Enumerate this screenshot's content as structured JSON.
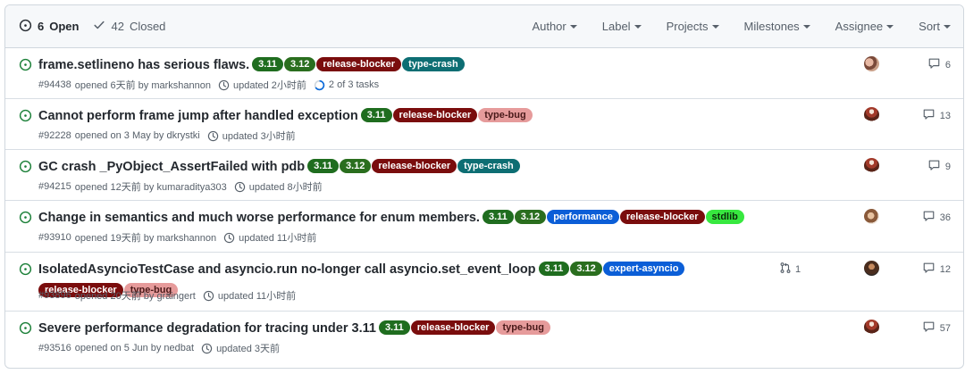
{
  "header": {
    "open": {
      "count": "6",
      "label": "Open"
    },
    "closed": {
      "count": "42",
      "label": "Closed"
    },
    "filters": [
      "Author",
      "Label",
      "Projects",
      "Milestones",
      "Assignee",
      "Sort"
    ]
  },
  "colors": {
    "open_green": "#1a7f37",
    "label_3_11": "#1f6d1f",
    "label_3_12": "#2a6e1e",
    "release_blocker": "#7a0d0d",
    "type_crash": "#0d6e73",
    "type_bug": "#e69b9b",
    "performance": "#0b5ed7",
    "stdlib": "#37e83f",
    "expert_asyncio": "#0b5ed7"
  },
  "issues": [
    {
      "title": "frame.setlineno has serious flaws.",
      "labels": [
        {
          "text": "3.11",
          "bg": "#1f6d1f",
          "fg": "#ffffff"
        },
        {
          "text": "3.12",
          "bg": "#2a6e1e",
          "fg": "#ffffff"
        },
        {
          "text": "release-blocker",
          "bg": "#7a0d0d",
          "fg": "#ffffff"
        },
        {
          "text": "type-crash",
          "bg": "#0d6e73",
          "fg": "#ffffff"
        }
      ],
      "number": "#94438",
      "opened": "opened 6天前 by markshannon",
      "updated": "updated 2小时前",
      "tasks": "2 of 3 tasks",
      "comments": "6",
      "avatar": "avatar-two-people"
    },
    {
      "title": "Cannot perform frame jump after handled exception",
      "labels": [
        {
          "text": "3.11",
          "bg": "#1f6d1f",
          "fg": "#ffffff"
        },
        {
          "text": "release-blocker",
          "bg": "#7a0d0d",
          "fg": "#ffffff"
        },
        {
          "text": "type-bug",
          "bg": "#e69b9b",
          "fg": "#4a1a1a"
        }
      ],
      "number": "#92228",
      "opened": "opened on 3 May by dkrystki",
      "updated": "updated 3小时前",
      "comments": "13",
      "avatar": "avatar-cake"
    },
    {
      "title": "GC crash _PyObject_AssertFailed with pdb",
      "labels": [
        {
          "text": "3.11",
          "bg": "#1f6d1f",
          "fg": "#ffffff"
        },
        {
          "text": "3.12",
          "bg": "#2a6e1e",
          "fg": "#ffffff"
        },
        {
          "text": "release-blocker",
          "bg": "#7a0d0d",
          "fg": "#ffffff"
        },
        {
          "text": "type-crash",
          "bg": "#0d6e73",
          "fg": "#ffffff"
        }
      ],
      "number": "#94215",
      "opened": "opened 12天前 by kumaraditya303",
      "updated": "updated 8小时前",
      "comments": "9",
      "avatar": "avatar-cake"
    },
    {
      "title": "Change in semantics and much worse performance for enum members.",
      "labels": [
        {
          "text": "3.11",
          "bg": "#1f6d1f",
          "fg": "#ffffff"
        },
        {
          "text": "3.12",
          "bg": "#2a6e1e",
          "fg": "#ffffff"
        },
        {
          "text": "performance",
          "bg": "#0b5ed7",
          "fg": "#ffffff"
        },
        {
          "text": "release-blocker",
          "bg": "#7a0d0d",
          "fg": "#ffffff"
        },
        {
          "text": "stdlib",
          "bg": "#37e83f",
          "fg": "#0a2a0a"
        }
      ],
      "number": "#93910",
      "opened": "opened 19天前 by markshannon",
      "updated": "updated 11小时前",
      "comments": "36",
      "avatar": "avatar-portrait"
    },
    {
      "title": "IsolatedAsyncioTestCase and asyncio.run no-longer call asyncio.set_event_loop",
      "labels": [
        {
          "text": "3.11",
          "bg": "#1f6d1f",
          "fg": "#ffffff"
        },
        {
          "text": "3.12",
          "bg": "#2a6e1e",
          "fg": "#ffffff"
        },
        {
          "text": "expert-asyncio",
          "bg": "#0b5ed7",
          "fg": "#ffffff"
        },
        {
          "text": "release-blocker",
          "bg": "#7a0d0d",
          "fg": "#ffffff"
        },
        {
          "text": "type-bug",
          "bg": "#e69b9b",
          "fg": "#4a1a1a"
        }
      ],
      "number": "#93896",
      "opened": "opened 20天前 by graingert",
      "updated": "updated 11小时前",
      "linked_prs": "1",
      "comments": "12",
      "avatar": "avatar-dark"
    },
    {
      "title": "Severe performance degradation for tracing under 3.11",
      "labels": [
        {
          "text": "3.11",
          "bg": "#1f6d1f",
          "fg": "#ffffff"
        },
        {
          "text": "release-blocker",
          "bg": "#7a0d0d",
          "fg": "#ffffff"
        },
        {
          "text": "type-bug",
          "bg": "#e69b9b",
          "fg": "#4a1a1a"
        }
      ],
      "number": "#93516",
      "opened": "opened on 5 Jun by nedbat",
      "updated": "updated 3天前",
      "comments": "57",
      "avatar": "avatar-cake"
    }
  ]
}
